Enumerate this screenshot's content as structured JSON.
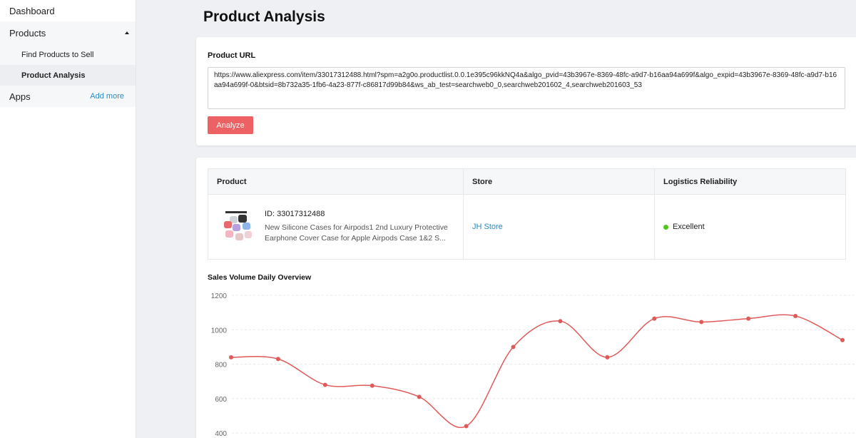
{
  "sidebar": {
    "dashboard": "Dashboard",
    "products": "Products",
    "find_products": "Find Products to Sell",
    "product_analysis": "Product Analysis",
    "apps": "Apps",
    "add_more": "Add more"
  },
  "page": {
    "title": "Product Analysis"
  },
  "url_section": {
    "label": "Product URL",
    "value": "https://www.aliexpress.com/item/33017312488.html?spm=a2g0o.productlist.0.0.1e395c96kkNQ4a&algo_pvid=43b3967e-8369-48fc-a9d7-b16aa94a699f&algo_expid=43b3967e-8369-48fc-a9d7-b16aa94a699f-0&btsid=8b732a35-1fb6-4a23-877f-c86817d99b84&ws_ab_test=searchweb0_0,searchweb201602_4,searchweb201603_53",
    "button": "Analyze"
  },
  "table": {
    "headers": [
      "Product",
      "Store",
      "Logistics Reliability"
    ],
    "row": {
      "product_id": "ID: 33017312488",
      "product_name": "New Silicone Cases for Airpods1 2nd Luxury Protective Earphone Cover Case for Apple Airpods Case 1&2 S...",
      "store": "JH Store",
      "logistics": "Excellent",
      "logistics_color": "#52c41a"
    }
  },
  "chart_title": "Sales Volume Daily Overview",
  "chart_data": {
    "type": "line",
    "title": "Sales Volume Daily Overview",
    "ylim": [
      400,
      1200
    ],
    "yticks": [
      1200,
      1000,
      800,
      600,
      400
    ],
    "values": [
      840,
      830,
      680,
      675,
      610,
      440,
      900,
      1050,
      840,
      1065,
      1045,
      1065,
      1080,
      940
    ],
    "color": "#e05a5a"
  },
  "colors": {
    "accent": "#eb6164",
    "link": "#2e8bc0"
  }
}
